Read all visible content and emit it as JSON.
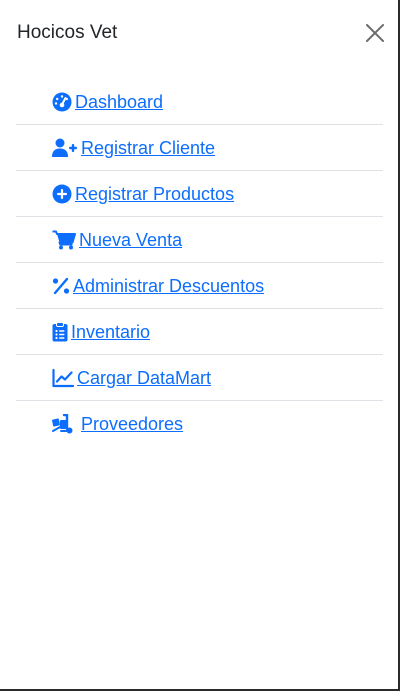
{
  "sidebar": {
    "title": "Hocicos Vet",
    "close_label": "×",
    "accent_color": "#0d6efd",
    "items": [
      {
        "label": "Dashboard",
        "icon": "gauge-icon"
      },
      {
        "label": "Registrar Cliente",
        "icon": "user-plus-icon"
      },
      {
        "label": "Registrar Productos",
        "icon": "circle-plus-icon"
      },
      {
        "label": "Nueva Venta",
        "icon": "cart-icon"
      },
      {
        "label": "Administrar Descuentos",
        "icon": "percent-icon"
      },
      {
        "label": "Inventario",
        "icon": "clipboard-list-icon"
      },
      {
        "label": "Cargar DataMart",
        "icon": "chart-line-icon"
      },
      {
        "label": "Proveedores",
        "icon": "truck-ramp-icon"
      }
    ]
  }
}
